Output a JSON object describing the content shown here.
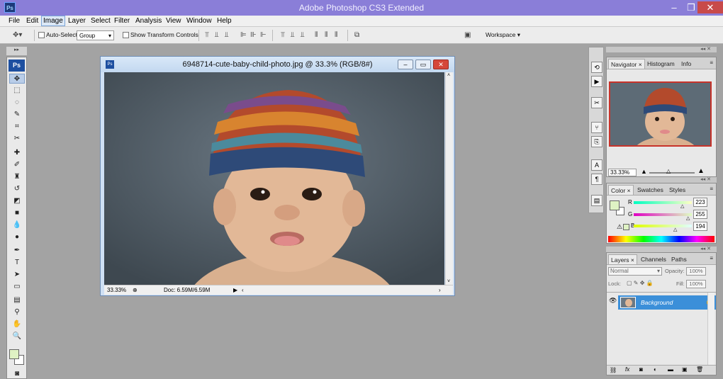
{
  "app": {
    "title": "Adobe Photoshop CS3 Extended",
    "logo": "Ps"
  },
  "menu": [
    "File",
    "Edit",
    "Image",
    "Layer",
    "Select",
    "Filter",
    "Analysis",
    "View",
    "Window",
    "Help"
  ],
  "menu_active": "Image",
  "options": {
    "auto_select_label": "Auto-Select:",
    "auto_select_value": "Group",
    "show_transform_label": "Show Transform Controls",
    "workspace_label": "Workspace ▾"
  },
  "document": {
    "title": "6948714-cute-baby-child-photo.jpg @ 33.3% (RGB/8#)",
    "zoom": "33.33%",
    "doc_size": "Doc: 6.59M/6.59M"
  },
  "panels": {
    "navigator": {
      "tabs": [
        "Navigator",
        "Histogram",
        "Info"
      ],
      "zoom": "33.33%"
    },
    "color": {
      "tabs": [
        "Color",
        "Swatches",
        "Styles"
      ],
      "r_label": "R",
      "g_label": "G",
      "b_label": "B",
      "r": "223",
      "g": "255",
      "b": "194",
      "swatch": "#dff2c4"
    },
    "layers": {
      "tabs": [
        "Layers",
        "Channels",
        "Paths"
      ],
      "blend_mode": "Normal",
      "opacity_label": "Opacity:",
      "opacity": "100%",
      "lock_label": "Lock:",
      "fill_label": "Fill:",
      "fill": "100%",
      "layer_name": "Background"
    }
  },
  "tools": [
    "move-tool",
    "marquee-tool",
    "lasso-tool",
    "quick-selection-tool",
    "crop-tool",
    "slice-tool",
    "healing-brush-tool",
    "brush-tool",
    "clone-stamp-tool",
    "history-brush-tool",
    "eraser-tool",
    "gradient-tool",
    "blur-tool",
    "dodge-tool",
    "pen-tool",
    "type-tool",
    "path-selection-tool",
    "rectangle-tool",
    "notes-tool",
    "eyedropper-tool",
    "hand-tool",
    "zoom-tool"
  ]
}
